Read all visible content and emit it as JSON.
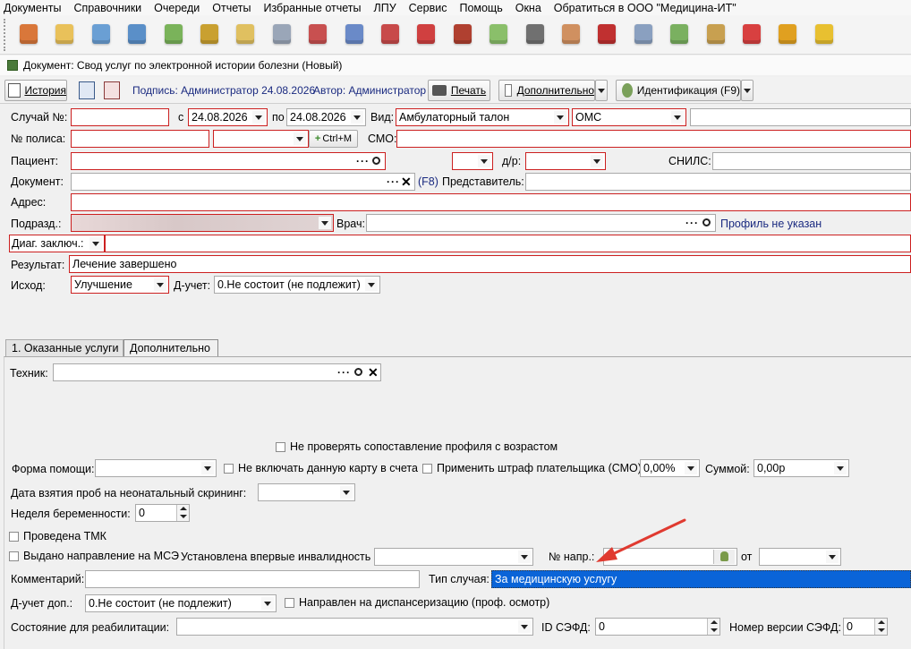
{
  "menu": [
    "Документы",
    "Справочники",
    "Очереди",
    "Отчеты",
    "Избранные отчеты",
    "ЛПУ",
    "Сервис",
    "Помощь",
    "Окна",
    "Обратиться в ООО \"Медицина-ИТ\""
  ],
  "toolbar_icons": [
    {
      "name": "doctor-icon",
      "color": "#d9773a"
    },
    {
      "name": "notebook-icon",
      "color": "#e9c15a"
    },
    {
      "name": "card-file-icon",
      "color": "#6a9fd4"
    },
    {
      "name": "id-card-icon",
      "color": "#5a8fc8"
    },
    {
      "name": "add-document-icon",
      "color": "#7ab35a"
    },
    {
      "name": "lab-flask-icon",
      "color": "#c9a030"
    },
    {
      "name": "edit-note-icon",
      "color": "#e0c060"
    },
    {
      "name": "syringe-icon",
      "color": "#9aa6b8"
    },
    {
      "name": "stamp-icon",
      "color": "#c85050"
    },
    {
      "name": "pharmacy-icon",
      "color": "#6a8ac8"
    },
    {
      "name": "medicine-pills-icon",
      "color": "#c84a4a"
    },
    {
      "name": "first-aid-icon",
      "color": "#d04040"
    },
    {
      "name": "reports-icon",
      "color": "#b04030"
    },
    {
      "name": "capsules-icon",
      "color": "#8abf6a"
    },
    {
      "name": "barcode-scanner-icon",
      "color": "#707070"
    },
    {
      "name": "nurse-icon",
      "color": "#d09060"
    },
    {
      "name": "red-book-icon",
      "color": "#c03030"
    },
    {
      "name": "calendar-icon",
      "color": "#8aa0c0"
    },
    {
      "name": "lock-document-icon",
      "color": "#7ab060"
    },
    {
      "name": "documents-icon",
      "color": "#c8a050"
    },
    {
      "name": "modules-icon",
      "color": "#d84040"
    },
    {
      "name": "padlock-icon",
      "color": "#e0a020"
    },
    {
      "name": "chat-icon",
      "color": "#e8c030"
    }
  ],
  "doc_title": "Документ: Свод услуг по электронной истории болезни (Новый)",
  "tb2": {
    "history": "История",
    "signature": "Подпись: Администратор 24.08.2026",
    "author": "Автор: Администратор",
    "print": "Печать",
    "additional": "Дополнительно",
    "ident": "Идентификация (F9)"
  },
  "form": {
    "case_label": "Случай №:",
    "from_label": "с",
    "date_from": "24.08.2026",
    "to_label": "по",
    "date_to": "24.08.2026",
    "kind_label": "Вид:",
    "kind_value": "Амбулаторный талон",
    "oms": "ОМС",
    "policy_label": "№ полиса:",
    "ctrlm": "Ctrl+M",
    "smo_label": "СМО:",
    "patient_label": "Пациент:",
    "dr_label": "д/р:",
    "snils_label": "СНИЛС:",
    "document_label": "Документ:",
    "f8": "(F8)",
    "representative_label": "Представитель:",
    "address_label": "Адрес:",
    "dept_label": "Подразд.:",
    "doctor_label": "Врач:",
    "profile": "Профиль не указан",
    "diag_label": "Диаг. заключ.:",
    "result_label": "Результат:",
    "result_value": "Лечение завершено",
    "outcome_label": "Исход:",
    "outcome_value": "Улучшение",
    "d_label": "Д-учет:",
    "d_value": "0.Не состоит (не подлежит)"
  },
  "tabs": [
    "1. Оказанные услуги",
    "Дополнительно"
  ],
  "panel": {
    "tech_label": "Техник:",
    "no_profile_check": "Не проверять сопоставление профиля с возрастом",
    "help_form_label": "Форма помощи:",
    "no_include": "Не включать данную карту в счета",
    "fine": "Применить штраф плательщика (СМО):",
    "fine_value": "0,00%",
    "sum_label": "Суммой:",
    "sum_value": "0,00р",
    "screening_label": "Дата взятия проб на неонатальный скрининг:",
    "week_label": "Неделя беременности:",
    "week_value": "0",
    "tmk": "Проведена ТМК",
    "mse": "Выдано направление на МСЭ",
    "disability_label": "Установлена впервые инвалидность",
    "napr_label": "№ напр.:",
    "ot_label": "от",
    "comment_label": "Комментарий:",
    "case_type_label": "Тип случая:",
    "case_type_value": "За медицинскую услугу",
    "d_dop_label": "Д-учет доп.:",
    "d_dop_value": "0.Не состоит (не подлежит)",
    "disp": "Направлен на диспансеризацию (проф. осмотр)",
    "rehab_label": "Состояние для реабилитации:",
    "sefd_label": "ID СЭФД:",
    "sefd_value": "0",
    "sefd_ver_label": "Номер версии СЭФД:",
    "sefd_ver_value": "0"
  }
}
